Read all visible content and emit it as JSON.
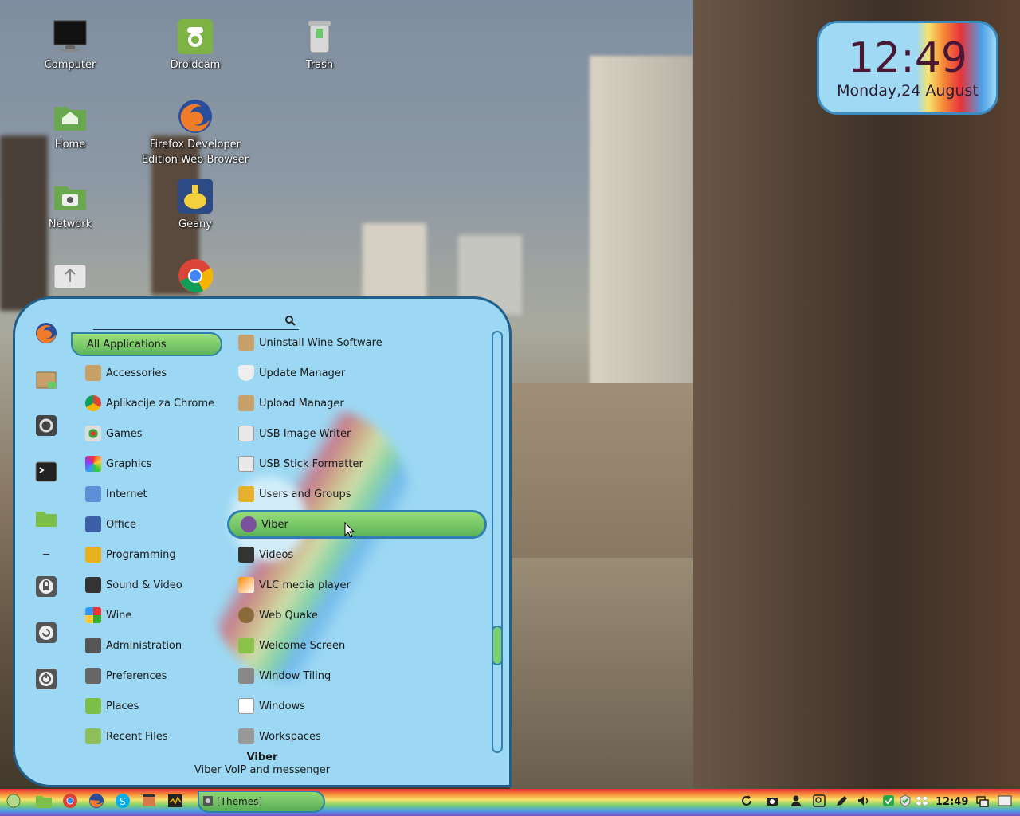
{
  "desktop": {
    "icons": [
      {
        "label": "Computer",
        "icon": "monitor-icon"
      },
      {
        "label": "Droidcam",
        "icon": "droidcam-icon"
      },
      {
        "label": "Trash",
        "icon": "trash-icon"
      },
      {
        "label": "Home",
        "icon": "home-folder-icon"
      },
      {
        "label": "Firefox Developer Edition Web Browser",
        "icon": "firefox-icon"
      },
      {
        "label": "Network",
        "icon": "network-folder-icon"
      },
      {
        "label": "Geany",
        "icon": "geany-icon"
      },
      {
        "label": "",
        "icon": "usb-drive-icon"
      },
      {
        "label": "",
        "icon": "chrome-icon"
      }
    ]
  },
  "clock": {
    "time": "12:49",
    "date": "Monday,24 August"
  },
  "menu": {
    "search": {
      "value": "",
      "placeholder": ""
    },
    "favorites": [
      "firefox-icon",
      "package-icon",
      "system-settings-icon",
      "terminal-icon",
      "folder-icon",
      "separator",
      "lock-screen-icon",
      "logout-icon",
      "power-icon"
    ],
    "categories": [
      {
        "label": "All Applications",
        "icon": "",
        "selected": true
      },
      {
        "label": "Accessories",
        "icon": "accessories-icon"
      },
      {
        "label": "Aplikacije za Chrome",
        "icon": "chrome-icon"
      },
      {
        "label": "Games",
        "icon": "games-icon"
      },
      {
        "label": "Graphics",
        "icon": "graphics-icon"
      },
      {
        "label": "Internet",
        "icon": "internet-icon"
      },
      {
        "label": "Office",
        "icon": "office-icon"
      },
      {
        "label": "Programming",
        "icon": "programming-icon"
      },
      {
        "label": "Sound & Video",
        "icon": "sound-video-icon"
      },
      {
        "label": "Wine",
        "icon": "wine-icon"
      },
      {
        "label": "Administration",
        "icon": "administration-icon"
      },
      {
        "label": "Preferences",
        "icon": "preferences-icon"
      },
      {
        "label": "Places",
        "icon": "places-folder-icon"
      },
      {
        "label": "Recent Files",
        "icon": "recent-files-icon"
      }
    ],
    "apps": [
      {
        "label": "Uninstall Wine Software",
        "icon": "uninstall-icon"
      },
      {
        "label": "Update Manager",
        "icon": "shield-icon"
      },
      {
        "label": "Upload Manager",
        "icon": "upload-icon"
      },
      {
        "label": "USB Image Writer",
        "icon": "usb-writer-icon"
      },
      {
        "label": "USB Stick Formatter",
        "icon": "usb-formatter-icon"
      },
      {
        "label": "Users and Groups",
        "icon": "users-icon"
      },
      {
        "label": "Viber",
        "icon": "viber-icon",
        "selected": true
      },
      {
        "label": "Videos",
        "icon": "videos-icon"
      },
      {
        "label": "VLC media player",
        "icon": "vlc-icon"
      },
      {
        "label": "Web Quake",
        "icon": "quake-icon"
      },
      {
        "label": "Welcome Screen",
        "icon": "mint-icon"
      },
      {
        "label": "Window Tiling",
        "icon": "tiling-icon"
      },
      {
        "label": "Windows",
        "icon": "windows-icon"
      },
      {
        "label": "Workspaces",
        "icon": "workspaces-icon"
      }
    ],
    "description": {
      "title": "Viber",
      "subtitle": "Viber VoIP and messenger"
    }
  },
  "panel": {
    "launchers": [
      "menu-icon",
      "files-icon",
      "chrome-icon",
      "firefox-icon",
      "skype-icon",
      "video-editor-icon",
      "system-monitor-icon"
    ],
    "task": {
      "label": "[Themes]",
      "icon": "themes-icon"
    },
    "tray": [
      "refresh-icon",
      "camera-icon",
      "user-icon",
      "key-icon",
      "pen-icon",
      "volume-icon",
      "shield-check-icon",
      "update-icon",
      "dropbox-icon"
    ],
    "time": "12:49",
    "tray_end": [
      "windows-switch-icon",
      "show-desktop-icon"
    ]
  },
  "colors": {
    "menu_bg": "#9cd8f3",
    "menu_border": "#1f5f8c",
    "selected_green": "#5fb55a"
  }
}
